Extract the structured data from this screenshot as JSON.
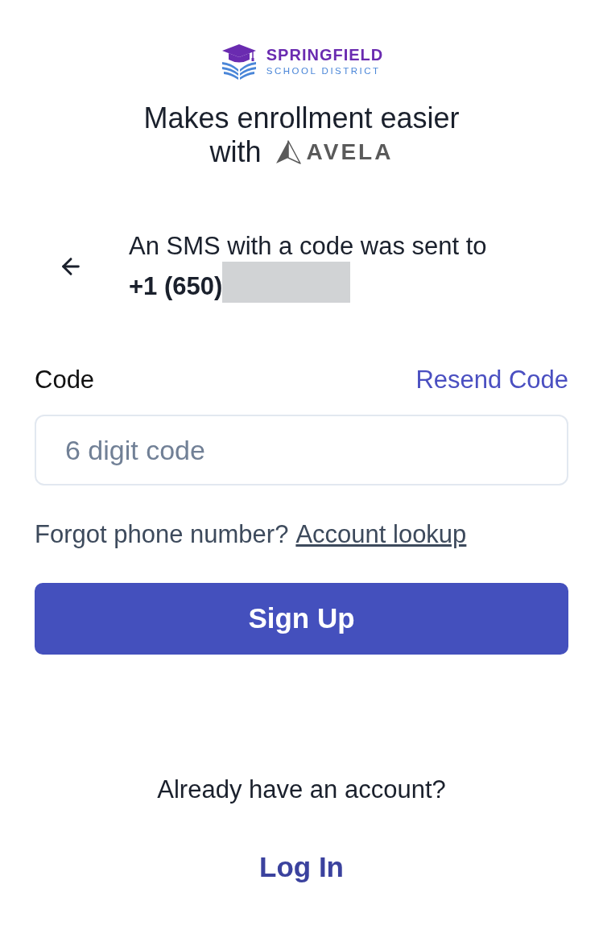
{
  "logo": {
    "name": "SPRINGFIELD",
    "subtitle": "SCHOOL DISTRICT"
  },
  "tagline": {
    "line_1": "Makes enrollment easier",
    "prefix": "with",
    "brand": "AVELA"
  },
  "sms_notice": {
    "message": "An SMS with a code was sent to",
    "phone": "+1 (650)",
    "phone_redacted": true
  },
  "code_field": {
    "label": "Code",
    "action": "Resend Code",
    "placeholder": "6 digit code"
  },
  "forgot": {
    "text": "Forgot phone number?",
    "link": "Account lookup"
  },
  "primary_button": "Sign Up",
  "footer": {
    "text": "Already have an account?",
    "link": "Log In"
  }
}
